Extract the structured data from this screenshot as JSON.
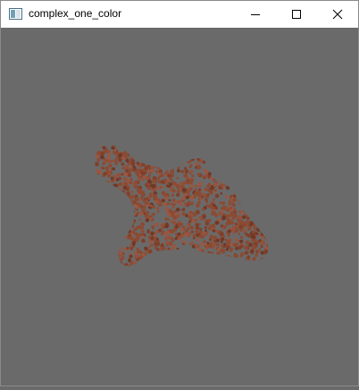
{
  "window": {
    "title": "complex_one_color",
    "background_color": "#6a6a6a",
    "titlebar_color": "#ffffff"
  },
  "titlebar": {
    "app_icon": "app-window-icon",
    "minimize_icon": "minimize-icon",
    "maximize_icon": "maximize-icon",
    "close_icon": "close-icon"
  },
  "canvas": {
    "content": "point-cloud-blob",
    "point_color": "#8b4a32"
  }
}
